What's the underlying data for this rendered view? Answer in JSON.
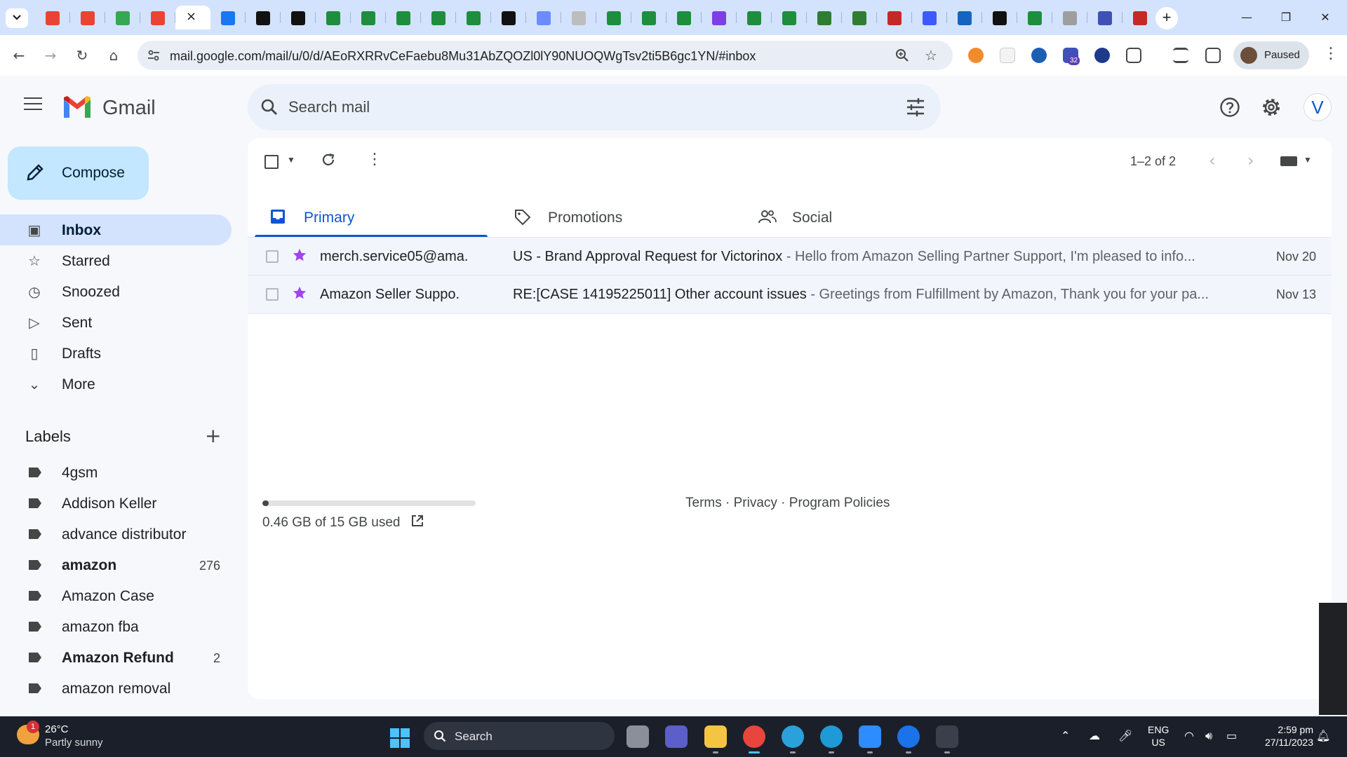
{
  "browser": {
    "tab_colors": [
      "#ea4335",
      "#ea4335",
      "#34a853",
      "#ea4335",
      "active",
      "#1877f2",
      "#111111",
      "#111111",
      "#1e8e3e",
      "#1e8e3e",
      "#1e8e3e",
      "#1e8e3e",
      "#1e8e3e",
      "#111111",
      "#6c8cff",
      "#bdbdbd",
      "#1e8e3e",
      "#1e8e3e",
      "#1e8e3e",
      "#7b3fe4",
      "#1e8e3e",
      "#1e8e3e",
      "#2e7d32",
      "#2e7d32",
      "#c62828",
      "#3d5afe",
      "#1565c0",
      "#111111",
      "#1e8e3e",
      "#9e9e9e",
      "#3f51b5",
      "#c62828"
    ],
    "active_tab_close": "×",
    "new_tab": "+",
    "window_controls": {
      "minimize": "—",
      "restore": "❐",
      "close": "✕"
    },
    "nav": {
      "back": "←",
      "forward": "→",
      "reload": "↻",
      "home": "⌂"
    },
    "url": "mail.google.com/mail/u/0/d/AEoRXRRvCeFaebu8Mu31AbZQOZl0lY90NUOQWgTsv2ti5B6gc1YN/#inbox",
    "star": "☆",
    "extension_badge": "32",
    "profile_status": "Paused",
    "menu": "⋮"
  },
  "gmail": {
    "logo_text": "Gmail",
    "search_placeholder": "Search mail",
    "account_initial": "V",
    "compose_label": "Compose",
    "nav_items": [
      {
        "label": "Inbox",
        "icon": "inbox-icon",
        "glyph": "▣"
      },
      {
        "label": "Starred",
        "icon": "star-icon",
        "glyph": "☆"
      },
      {
        "label": "Snoozed",
        "icon": "clock-icon",
        "glyph": "◷"
      },
      {
        "label": "Sent",
        "icon": "send-icon",
        "glyph": "▷"
      },
      {
        "label": "Drafts",
        "icon": "draft-icon",
        "glyph": "▯"
      },
      {
        "label": "More",
        "icon": "chevron-down-icon",
        "glyph": "⌄"
      }
    ],
    "labels_heading": "Labels",
    "labels_add": "+",
    "labels": [
      {
        "name": "4gsm",
        "count": "",
        "bold": false
      },
      {
        "name": "Addison Keller",
        "count": "",
        "bold": false
      },
      {
        "name": "advance distributor",
        "count": "",
        "bold": false
      },
      {
        "name": "amazon",
        "count": "276",
        "bold": true
      },
      {
        "name": "Amazon Case",
        "count": "",
        "bold": false
      },
      {
        "name": "amazon fba",
        "count": "",
        "bold": false
      },
      {
        "name": "Amazon Refund",
        "count": "2",
        "bold": true
      },
      {
        "name": "amazon removal",
        "count": "",
        "bold": false
      }
    ],
    "pager": "1–2 of 2",
    "pager_prev": "‹",
    "pager_next": "›",
    "more_actions": "⋮",
    "categories": [
      {
        "label": "Primary",
        "icon": "inbox-icon"
      },
      {
        "label": "Promotions",
        "icon": "tag-icon"
      },
      {
        "label": "Social",
        "icon": "people-icon"
      }
    ],
    "emails": [
      {
        "sender": "merch.service05@ama.",
        "subject": "US - Brand Approval Request for Victorinox",
        "snippet": " - Hello from Amazon Selling Partner Support, I'm pleased to info...",
        "date": "Nov 20"
      },
      {
        "sender": "Amazon Seller Suppo.",
        "subject": "RE:[CASE 14195225011] Other account issues",
        "snippet": " - Greetings from Fulfillment by Amazon, Thank you for your pa...",
        "date": "Nov 13"
      }
    ],
    "storage": {
      "text": "0.46 GB of 15 GB used",
      "used_fraction": 0.031
    },
    "footer": "Terms · Privacy · Program Policies",
    "colors": {
      "accent": "#0b57d0",
      "compose_bg": "#c2e7ff",
      "star": "#a142f4"
    }
  },
  "taskbar": {
    "weather_badge": "1",
    "temperature": "26°C",
    "weather": "Partly sunny",
    "search_label": "Search",
    "apps": [
      {
        "name": "file-explorer-icon",
        "color": "#f4c542"
      },
      {
        "name": "chrome-icon",
        "color": "#e8453c"
      },
      {
        "name": "telegram-icon",
        "color": "#2aa1da"
      },
      {
        "name": "edge-icon",
        "color": "#1e9ad6"
      },
      {
        "name": "zoom-icon",
        "color": "#2d8cff"
      },
      {
        "name": "vpn-icon",
        "color": "#1a73e8"
      },
      {
        "name": "calculator-icon",
        "color": "#3a3f4b"
      }
    ],
    "lang_line1": "ENG",
    "lang_line2": "US",
    "time": "2:59 pm",
    "date": "27/11/2023"
  }
}
